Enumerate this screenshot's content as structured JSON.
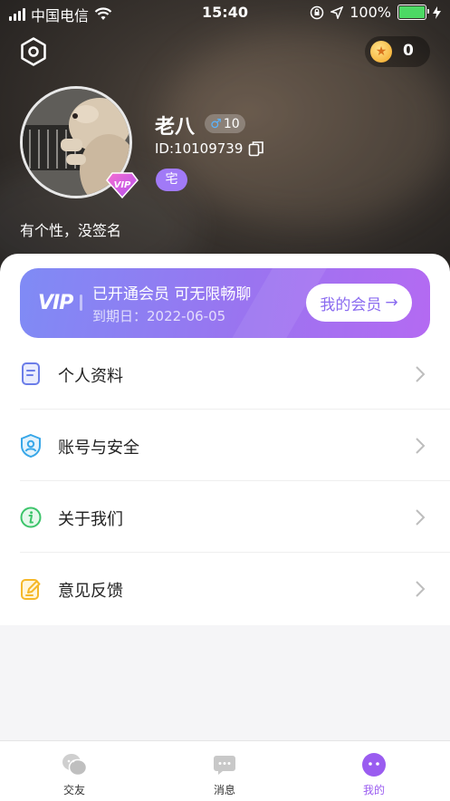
{
  "status_bar": {
    "carrier": "中国电信",
    "time": "15:40",
    "battery": "100%"
  },
  "header": {
    "coin_count": "0",
    "username": "老八",
    "gender_symbol": "♂",
    "age": "10",
    "user_id": "ID:10109739",
    "tag": "宅",
    "signature": "有个性，没签名",
    "vip_badge_text": "VIP"
  },
  "vip_banner": {
    "logo": "VIP",
    "title": "已开通会员 可无限畅聊",
    "expire": "到期日：2022-06-05",
    "button_label": "我的会员",
    "button_arrow": "→"
  },
  "menu": [
    {
      "label": "个人资料",
      "icon": "profile-document-icon",
      "color": "#6b7de8"
    },
    {
      "label": "账号与安全",
      "icon": "shield-user-icon",
      "color": "#38a7e8"
    },
    {
      "label": "关于我们",
      "icon": "info-icon",
      "color": "#3cc46a"
    },
    {
      "label": "意见反馈",
      "icon": "edit-feedback-icon",
      "color": "#f5b82a"
    }
  ],
  "tabbar": [
    {
      "label": "交友",
      "icon": "chat-bubbles-icon",
      "active": false
    },
    {
      "label": "消息",
      "icon": "message-icon",
      "active": false
    },
    {
      "label": "我的",
      "icon": "profile-face-icon",
      "active": true
    }
  ],
  "colors": {
    "accent": "#8b6cf0",
    "tab_active": "#9a5cf0",
    "tab_inactive": "#c8c8c8"
  }
}
